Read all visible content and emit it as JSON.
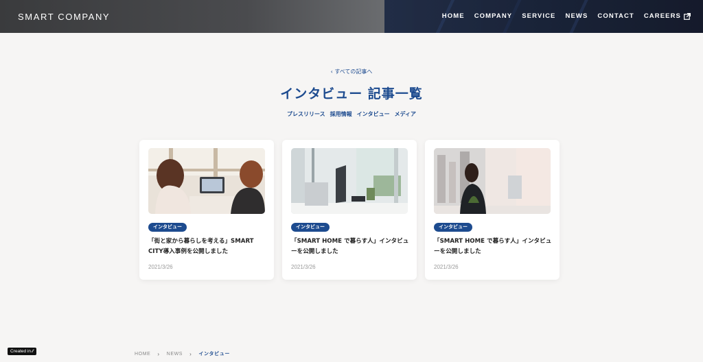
{
  "header": {
    "logo": "SMART COMPANY",
    "nav": [
      "HOME",
      "COMPANY",
      "SERVICE",
      "NEWS",
      "CONTACT",
      "CAREERS"
    ]
  },
  "main": {
    "back_link": "すべての記事へ",
    "title": "インタビュー 記事一覧",
    "categories": [
      "プレスリリース",
      "採用情報",
      "インタビュー",
      "メディア"
    ]
  },
  "cards": [
    {
      "tag": "インタビュー",
      "title": "「街と家から暮らしを考える」SMART CITY導入事例を公開しました",
      "date": "2021/3/26"
    },
    {
      "tag": "インタビュー",
      "title": "「SMART HOME で暮らす人」インタビューを公開しました",
      "date": "2021/3/26"
    },
    {
      "tag": "インタビュー",
      "title": "「SMART HOME で暮らす人」インタビューを公開しました",
      "date": "2021/3/26"
    }
  ],
  "breadcrumb": [
    "HOME",
    "NEWS",
    "インタビュー"
  ],
  "badge": "Created in",
  "colors": {
    "accent": "#1d4b8f",
    "background": "#f6f5f4"
  }
}
